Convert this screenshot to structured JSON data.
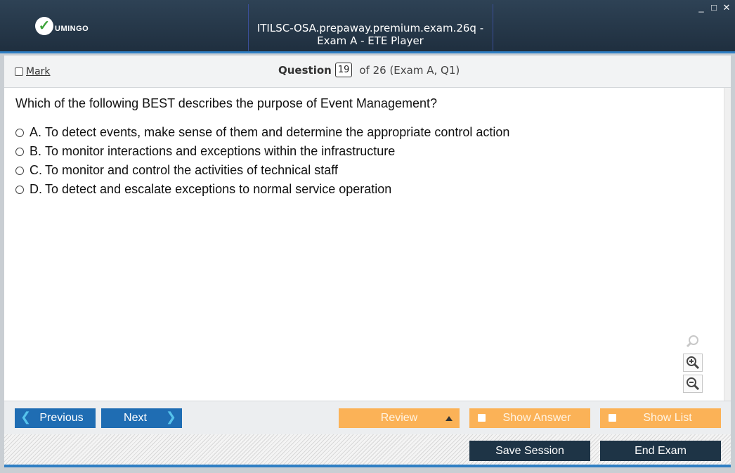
{
  "window": {
    "title": "ITILSC-OSA.prepaway.premium.exam.26q - Exam A - ETE Player",
    "brand": "UMINGO",
    "controls": [
      "_",
      "□",
      "✕"
    ]
  },
  "header": {
    "mark_label": "Mark",
    "question_label": "Question",
    "question_number": "19",
    "question_of": "of 26 (Exam A, Q1)"
  },
  "question": {
    "text": "Which of the following BEST describes the purpose of Event Management?",
    "answers": [
      {
        "letter": "A.",
        "text": "To detect events, make sense of them and determine the appropriate control action"
      },
      {
        "letter": "B.",
        "text": "To monitor interactions and exceptions within the infrastructure"
      },
      {
        "letter": "C.",
        "text": "To monitor and control the activities of technical staff"
      },
      {
        "letter": "D.",
        "text": "To detect and escalate exceptions to normal service operation"
      }
    ]
  },
  "zoom": {
    "icons": [
      "zoom-reset-icon",
      "zoom-in-icon",
      "zoom-out-icon"
    ]
  },
  "nav": {
    "previous_label": "Previous",
    "next_label": "Next",
    "review_label": "Review",
    "show_answer_label": "Show Answer",
    "show_list_label": "Show List"
  },
  "footer": {
    "save_session_label": "Save Session",
    "end_exam_label": "End Exam"
  },
  "colors": {
    "titlebar": "#253749",
    "accent_blue": "#1f6db3",
    "orange": "#fbb257",
    "dark_button": "#1e3446",
    "brand_green": "#3ea33a"
  }
}
